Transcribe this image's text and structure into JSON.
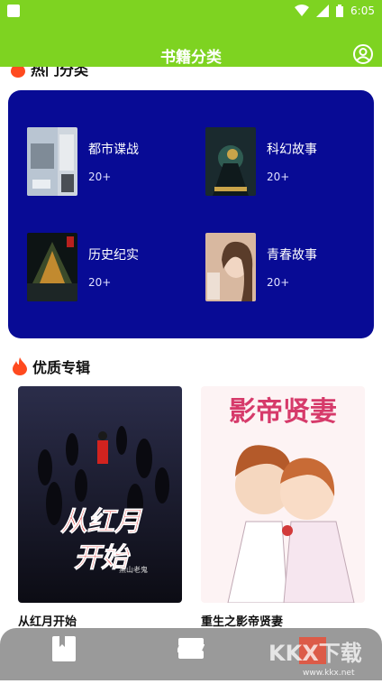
{
  "status_bar": {
    "time": "6:05"
  },
  "header": {
    "title": "书籍分类"
  },
  "hot_section": {
    "title": "热门分类"
  },
  "categories": [
    {
      "name": "都市谍战",
      "count": "20+"
    },
    {
      "name": "科幻故事",
      "count": "20+"
    },
    {
      "name": "历史纪实",
      "count": "20+"
    },
    {
      "name": "青春故事",
      "count": "20+"
    }
  ],
  "featured_section": {
    "title": "优质专辑"
  },
  "featured_books": [
    {
      "title": "从红月开始",
      "cover_text": "从红月开始",
      "author": "黑山老鬼"
    },
    {
      "title": "重生之影帝贤妻",
      "cover_text": "影帝贤妻"
    }
  ],
  "watermark": {
    "text": "KKX下载",
    "url": "www.kkx.net"
  },
  "colors": {
    "accent": "#7ed321",
    "panel": "#080b95",
    "fire": "#ff4a1f"
  },
  "icons": [
    "fire-icon",
    "profile-icon",
    "book-icon",
    "bookshelf-icon"
  ]
}
